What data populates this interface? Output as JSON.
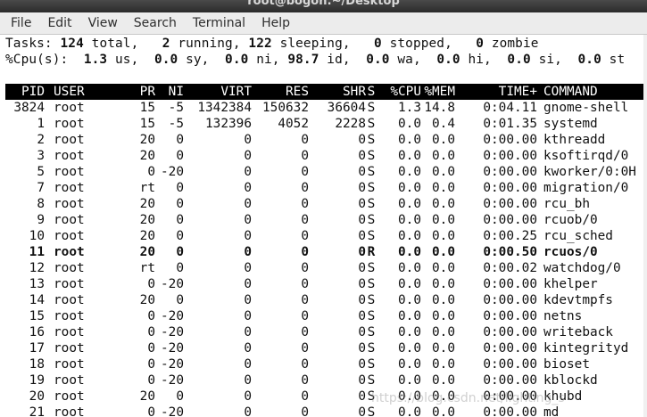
{
  "window": {
    "title": "root@bogon:~/Desktop"
  },
  "menu": [
    "File",
    "Edit",
    "View",
    "Search",
    "Terminal",
    "Help"
  ],
  "summary": {
    "tasks_label": "Tasks:",
    "tasks_total": "124",
    "tasks_total_label": "total,",
    "tasks_running": "2",
    "tasks_running_label": "running,",
    "tasks_sleeping": "122",
    "tasks_sleeping_label": "sleeping,",
    "tasks_stopped": "0",
    "tasks_stopped_label": "stopped,",
    "tasks_zombie": "0",
    "tasks_zombie_label": "zombie",
    "cpu_label": "%Cpu(s):",
    "cpu_us": "1.3",
    "cpu_us_label": "us,",
    "cpu_sy": "0.0",
    "cpu_sy_label": "sy,",
    "cpu_ni": "0.0",
    "cpu_ni_label": "ni,",
    "cpu_id": "98.7",
    "cpu_id_label": "id,",
    "cpu_wa": "0.0",
    "cpu_wa_label": "wa,",
    "cpu_hi": "0.0",
    "cpu_hi_label": "hi,",
    "cpu_si": "0.0",
    "cpu_si_label": "si,",
    "cpu_st": "0.0",
    "cpu_st_label": "st"
  },
  "table": {
    "columns": [
      "PID",
      "USER",
      "PR",
      "NI",
      "VIRT",
      "RES",
      "SHR",
      "S",
      "%CPU",
      "%MEM",
      "TIME+",
      "COMMAND"
    ],
    "rows": [
      [
        "3824",
        "root",
        "15",
        "-5",
        "1342384",
        "150632",
        "36604",
        "S",
        "1.3",
        "14.8",
        "0:04.11",
        "gnome-shell"
      ],
      [
        "1",
        "root",
        "15",
        "-5",
        "132396",
        "4052",
        "2228",
        "S",
        "0.0",
        "0.4",
        "0:01.35",
        "systemd"
      ],
      [
        "2",
        "root",
        "20",
        "0",
        "0",
        "0",
        "0",
        "S",
        "0.0",
        "0.0",
        "0:00.00",
        "kthreadd"
      ],
      [
        "3",
        "root",
        "20",
        "0",
        "0",
        "0",
        "0",
        "S",
        "0.0",
        "0.0",
        "0:00.00",
        "ksoftirqd/0"
      ],
      [
        "5",
        "root",
        "0",
        "-20",
        "0",
        "0",
        "0",
        "S",
        "0.0",
        "0.0",
        "0:00.00",
        "kworker/0:0H"
      ],
      [
        "7",
        "root",
        "rt",
        "0",
        "0",
        "0",
        "0",
        "S",
        "0.0",
        "0.0",
        "0:00.00",
        "migration/0"
      ],
      [
        "8",
        "root",
        "20",
        "0",
        "0",
        "0",
        "0",
        "S",
        "0.0",
        "0.0",
        "0:00.00",
        "rcu_bh"
      ],
      [
        "9",
        "root",
        "20",
        "0",
        "0",
        "0",
        "0",
        "S",
        "0.0",
        "0.0",
        "0:00.00",
        "rcuob/0"
      ],
      [
        "10",
        "root",
        "20",
        "0",
        "0",
        "0",
        "0",
        "S",
        "0.0",
        "0.0",
        "0:00.25",
        "rcu_sched"
      ],
      [
        "11",
        "root",
        "20",
        "0",
        "0",
        "0",
        "0",
        "R",
        "0.0",
        "0.0",
        "0:00.50",
        "rcuos/0"
      ],
      [
        "12",
        "root",
        "rt",
        "0",
        "0",
        "0",
        "0",
        "S",
        "0.0",
        "0.0",
        "0:00.02",
        "watchdog/0"
      ],
      [
        "13",
        "root",
        "0",
        "-20",
        "0",
        "0",
        "0",
        "S",
        "0.0",
        "0.0",
        "0:00.00",
        "khelper"
      ],
      [
        "14",
        "root",
        "20",
        "0",
        "0",
        "0",
        "0",
        "S",
        "0.0",
        "0.0",
        "0:00.00",
        "kdevtmpfs"
      ],
      [
        "15",
        "root",
        "0",
        "-20",
        "0",
        "0",
        "0",
        "S",
        "0.0",
        "0.0",
        "0:00.00",
        "netns"
      ],
      [
        "16",
        "root",
        "0",
        "-20",
        "0",
        "0",
        "0",
        "S",
        "0.0",
        "0.0",
        "0:00.00",
        "writeback"
      ],
      [
        "17",
        "root",
        "0",
        "-20",
        "0",
        "0",
        "0",
        "S",
        "0.0",
        "0.0",
        "0:00.00",
        "kintegrityd"
      ],
      [
        "18",
        "root",
        "0",
        "-20",
        "0",
        "0",
        "0",
        "S",
        "0.0",
        "0.0",
        "0:00.00",
        "bioset"
      ],
      [
        "19",
        "root",
        "0",
        "-20",
        "0",
        "0",
        "0",
        "S",
        "0.0",
        "0.0",
        "0:00.00",
        "kblockd"
      ],
      [
        "20",
        "root",
        "20",
        "0",
        "0",
        "0",
        "0",
        "S",
        "0.0",
        "0.0",
        "0:00.00",
        "khubd"
      ],
      [
        "21",
        "root",
        "0",
        "-20",
        "0",
        "0",
        "0",
        "S",
        "0.0",
        "0.0",
        "0:00.00",
        "md"
      ]
    ],
    "highlighted_pid": "11"
  },
  "watermark": "https://blog.csdn.net/lighting_s",
  "colors": {
    "header_bg": "#000000",
    "header_fg": "#ffffff",
    "terminal_bg": "#ffffff",
    "terminal_fg": "#111111"
  }
}
